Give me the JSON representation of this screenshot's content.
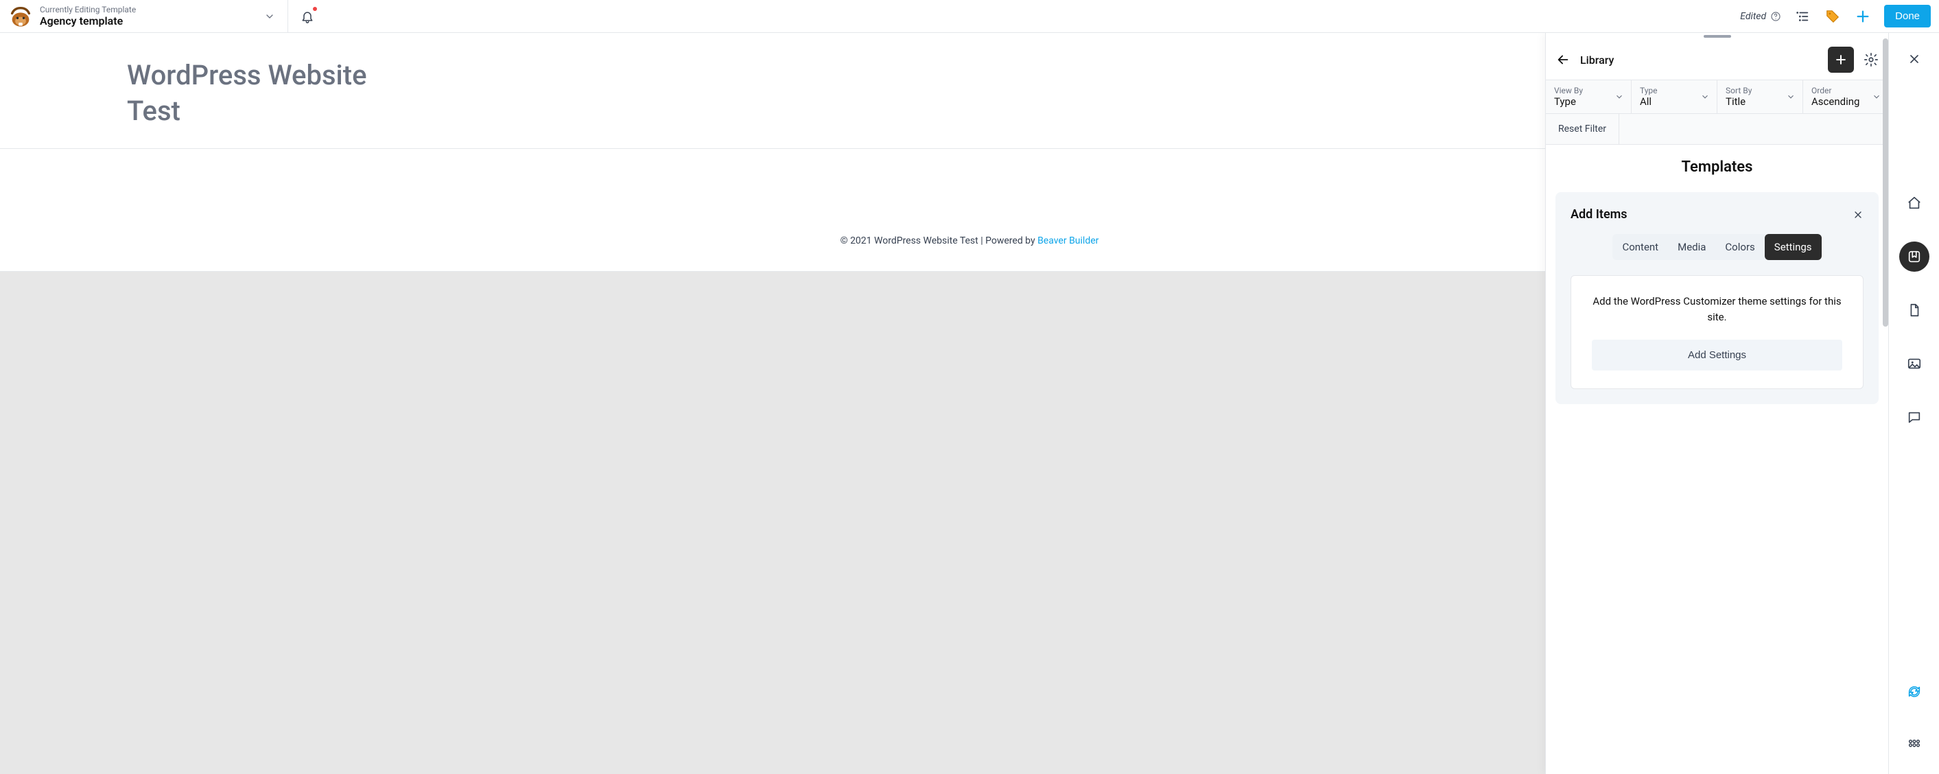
{
  "topbar": {
    "subtitle": "Currently Editing Template",
    "title": "Agency template",
    "edited_label": "Edited",
    "done_label": "Done"
  },
  "canvas": {
    "site_title_line1": "WordPress Website",
    "site_title_line2": "Test",
    "footer_prefix": "© 2021 WordPress Website Test | Powered by ",
    "footer_link": "Beaver Builder"
  },
  "library": {
    "header_label": "Library",
    "filters": {
      "view_by": {
        "label": "View By",
        "value": "Type"
      },
      "type": {
        "label": "Type",
        "value": "All"
      },
      "sort_by": {
        "label": "Sort By",
        "value": "Title"
      },
      "order": {
        "label": "Order",
        "value": "Ascending"
      }
    },
    "reset_label": "Reset Filter",
    "section_title": "Templates",
    "card": {
      "title": "Add Items",
      "tabs": {
        "content": "Content",
        "media": "Media",
        "colors": "Colors",
        "settings": "Settings"
      },
      "description": "Add the WordPress Customizer theme settings for this site.",
      "button": "Add Settings"
    }
  }
}
